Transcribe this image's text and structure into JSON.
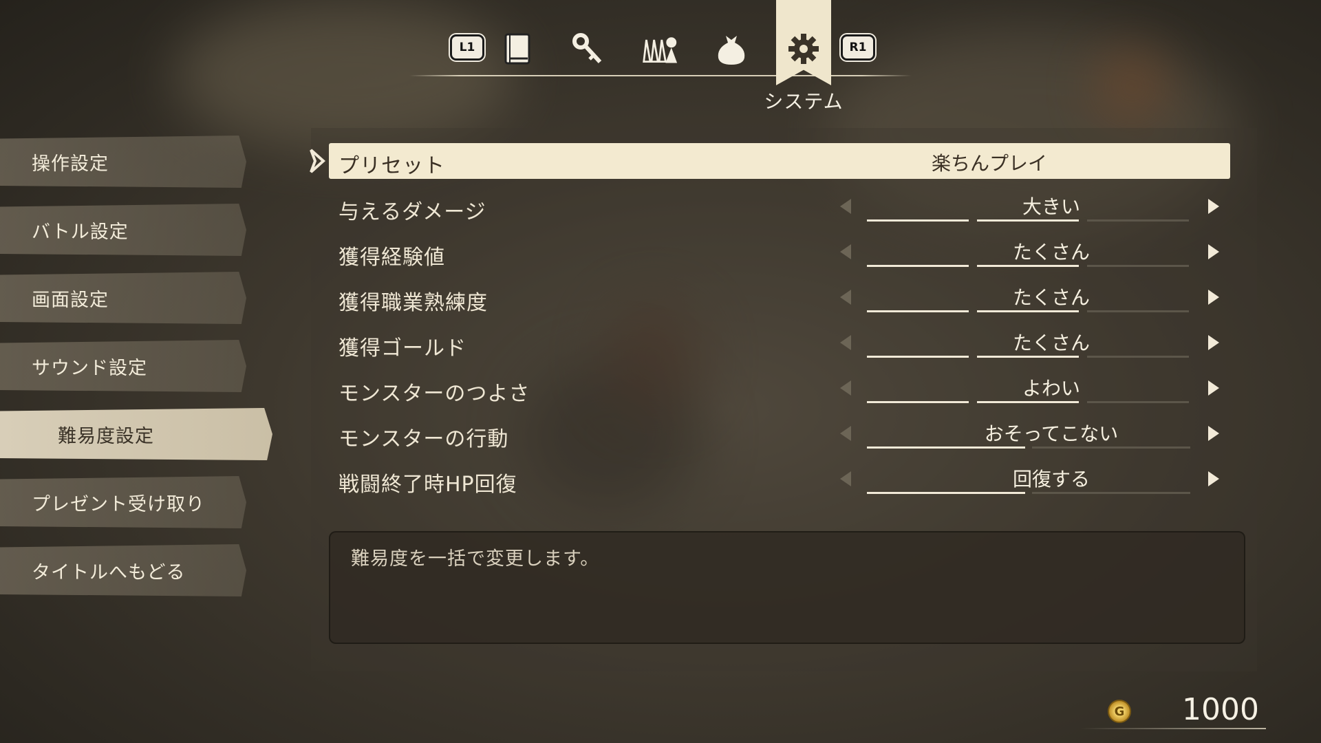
{
  "top_tabs": {
    "left_button": "L1",
    "right_button": "R1",
    "icons": [
      "book-icon",
      "key-icon",
      "party-icon",
      "bag-icon",
      "gear-icon"
    ],
    "active_label": "システム"
  },
  "side_menu": [
    {
      "label": "操作設定",
      "active": false
    },
    {
      "label": "バトル設定",
      "active": false
    },
    {
      "label": "画面設定",
      "active": false
    },
    {
      "label": "サウンド設定",
      "active": false
    },
    {
      "label": "難易度設定",
      "active": true
    },
    {
      "label": "プレゼント受け取り",
      "active": false
    },
    {
      "label": "タイトルへもどる",
      "active": false
    }
  ],
  "preset": {
    "label": "プリセット",
    "value": "楽ちんプレイ"
  },
  "settings": [
    {
      "label": "与えるダメージ",
      "value": "大きい",
      "level": 2,
      "max": 3
    },
    {
      "label": "獲得経験値",
      "value": "たくさん",
      "level": 2,
      "max": 3
    },
    {
      "label": "獲得職業熟練度",
      "value": "たくさん",
      "level": 2,
      "max": 3
    },
    {
      "label": "獲得ゴールド",
      "value": "たくさん",
      "level": 2,
      "max": 3
    },
    {
      "label": "モンスターのつよさ",
      "value": "よわい",
      "level": 2,
      "max": 3
    },
    {
      "label": "モンスターの行動",
      "value": "おそってこない",
      "level": 1,
      "max": 2
    },
    {
      "label": "戦闘終了時HP回復",
      "value": "回復する",
      "level": 1,
      "max": 2
    }
  ],
  "description": "難易度を一括で変更します。",
  "gold": {
    "value": "1000",
    "icon": "gold-coin-icon",
    "symbol": "G"
  }
}
